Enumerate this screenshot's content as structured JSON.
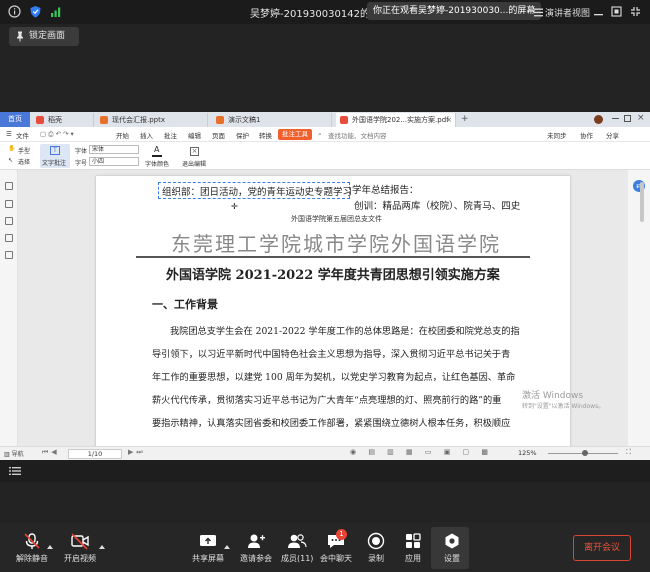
{
  "meeting": {
    "title": "吴梦婷-201930030142的快",
    "watching_banner": "你正在观看吴梦婷-201930030...的屏幕",
    "presenter_view": "演讲者视图",
    "lock_screen": "锁定画面"
  },
  "wps": {
    "home_tab": "首页",
    "tabs": [
      {
        "label": "稻壳",
        "color": "#e74c3c"
      },
      {
        "label": "现代会汇报.pptx",
        "color": "#e8702a"
      },
      {
        "label": "演示文稿1",
        "color": "#e8702a"
      },
      {
        "label": "外国语学院202...实施方案.pdf",
        "color": "#e74c3c"
      }
    ],
    "menu": {
      "file": "文件",
      "items": [
        "开始",
        "插入",
        "批注",
        "编辑",
        "页面",
        "保护",
        "转换"
      ],
      "pdf_tools": "批注工具",
      "search": "查找功能、文档内容",
      "sync": "未同步",
      "collab": "协作",
      "share": "分享"
    },
    "toolbar": {
      "hand": "手型",
      "select": "选择",
      "text_annot": "文字批注",
      "font_label": "字体",
      "font_value": "宋体",
      "size_label": "字号",
      "size_value": "小四",
      "font_color": "字体颜色",
      "exit_edit": "退出编辑"
    },
    "document": {
      "annotation": "组织部：团日活动，党的青年运动史专题学习",
      "header_right_1": "学年总结报告：",
      "header_right_2": "创训：精品两库（校院）、院青马、四史",
      "doc_ref": "外国语学院第五届团总支文件",
      "institution": "东莞理工学院城市学院外国语学院",
      "title": "外国语学院 2021-2022 学年度共青团思想引领实施方案",
      "section1": "一、工作背景",
      "para": [
        "我院团总支学生会在 2021-2022 学年度工作的总体思路是：在校团委和院党总支的指",
        "导引领下，以习近平新时代中国特色社会主义思想为指导，深入贯彻习近平总书记关于青",
        "年工作的重要思想，以建党 100 周年为契机，以党史学习教育为起点，让红色基因、革命",
        "薪火代代传承，贯彻落实习近平总书记为广大青年“点亮理想的灯、照亮前行的路”的重",
        "要指示精神，认真落实团省委和校团委工作部署，紧紧围绕立德树人根本任务，积极顺应"
      ]
    },
    "watermark": {
      "line1": "激活 Windows",
      "line2": "转到\"设置\"以激活 Windows。"
    },
    "status": {
      "nav": "导航",
      "page": "1/10",
      "zoom": "125%"
    }
  },
  "controls": {
    "unmute": "解除静音",
    "start_video": "开启视频",
    "share_screen": "共享屏幕",
    "invite": "邀请参会",
    "members": "成员(11)",
    "chat": "会中聊天",
    "chat_badge": "1",
    "record": "录制",
    "apps": "应用",
    "settings": "设置",
    "leave": "离开会议"
  }
}
